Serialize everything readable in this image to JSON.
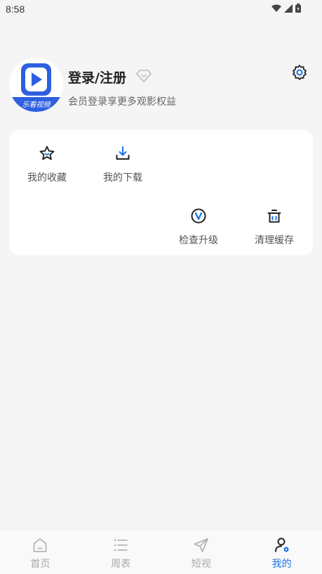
{
  "status_bar": {
    "time": "8:58"
  },
  "profile": {
    "title": "登录/注册",
    "subtitle": "会员登录享更多观影权益",
    "logo_text": "乐看视频"
  },
  "menu": {
    "items": [
      {
        "label": "我的收藏",
        "icon": "star-icon"
      },
      {
        "label": "我的下载",
        "icon": "download-icon"
      },
      {
        "label": "检查升级",
        "icon": "upgrade-icon"
      },
      {
        "label": "清理缓存",
        "icon": "trash-icon"
      }
    ]
  },
  "nav": {
    "items": [
      {
        "label": "首页",
        "icon": "home-icon"
      },
      {
        "label": "周表",
        "icon": "list-icon"
      },
      {
        "label": "短视",
        "icon": "send-icon"
      },
      {
        "label": "我的",
        "icon": "user-icon"
      }
    ]
  },
  "colors": {
    "accent": "#1a73e8",
    "brand": "#2d5fe0",
    "background": "#f5f5f6"
  }
}
